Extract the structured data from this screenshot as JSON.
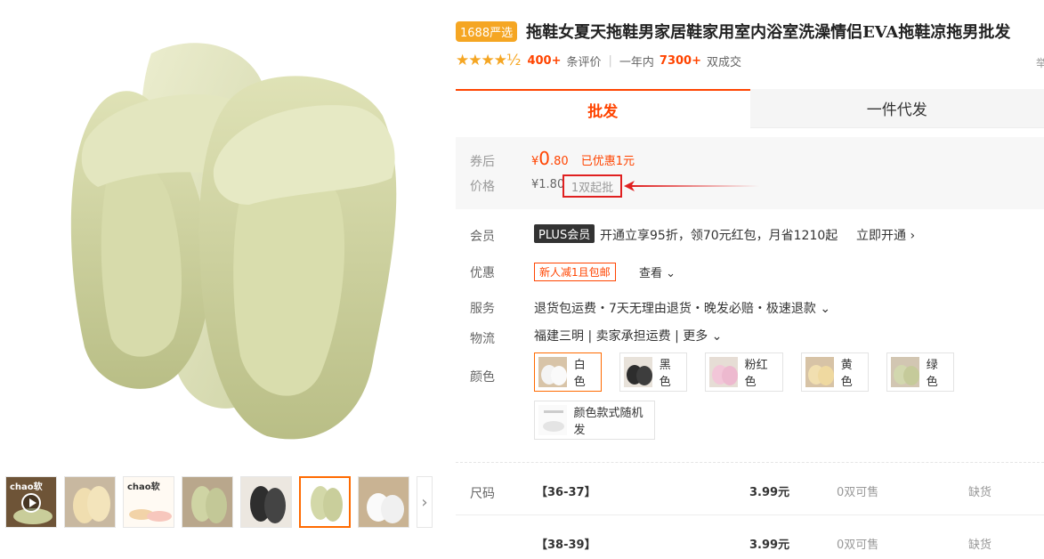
{
  "product": {
    "badge": "1688严选",
    "title": "拖鞋女夏天拖鞋男家居鞋家用室内浴室洗澡情侣EVA拖鞋凉拖男批发",
    "title_right_fragment": "举"
  },
  "rating": {
    "stars": "★★★★½",
    "review_count": "400+",
    "review_label": "条评价",
    "period_label": "一年内",
    "sold_count": "7300+",
    "sold_label": "双成交"
  },
  "tabs": [
    {
      "label": "批发",
      "active": true
    },
    {
      "label": "一件代发",
      "active": false
    }
  ],
  "price": {
    "after_label": "券后",
    "after_currency": "¥",
    "after_int": "0",
    "after_dec": ".80",
    "saved": "已优惠1元",
    "price_label": "价格",
    "orig_price": "¥1.80",
    "min_order": "1双起批"
  },
  "member": {
    "label": "会员",
    "badge": "PLUS会员",
    "text": "开通立享95折，领70元红包，月省1210起",
    "link": "立即开通 ›"
  },
  "promotion": {
    "label": "优惠",
    "tag": "新人减1且包邮",
    "more": "查看 ⌄"
  },
  "service": {
    "label": "服务",
    "text": "退货包运费・7天无理由退货・晚发必赔・极速退款 ⌄"
  },
  "logistics": {
    "label": "物流",
    "text": "福建三明 | 卖家承担运费 | 更多 ⌄"
  },
  "colors": {
    "label": "颜色",
    "options": [
      {
        "name": "白色",
        "swatch": "#f4f4f4",
        "active": true
      },
      {
        "name": "黑色",
        "swatch": "#333333",
        "active": false
      },
      {
        "name": "粉红色",
        "swatch": "#f2c6d8",
        "active": false
      },
      {
        "name": "黄色",
        "swatch": "#f1dfb0",
        "active": false
      },
      {
        "name": "绿色",
        "swatch": "#d2d7ae",
        "active": false
      },
      {
        "name": "颜色款式随机发",
        "swatch": "#eeeeee",
        "active": false
      }
    ]
  },
  "sizes": {
    "label": "尺码",
    "rows": [
      {
        "name": "【36-37】",
        "price": "3.99元",
        "stock": "0双可售",
        "status": "缺货"
      },
      {
        "name": "【38-39】",
        "price": "3.99元",
        "stock": "0双可售",
        "status": "缺货"
      }
    ]
  },
  "gallery": {
    "thumb1_text": "chao软",
    "thumb3_text": "chao软"
  }
}
